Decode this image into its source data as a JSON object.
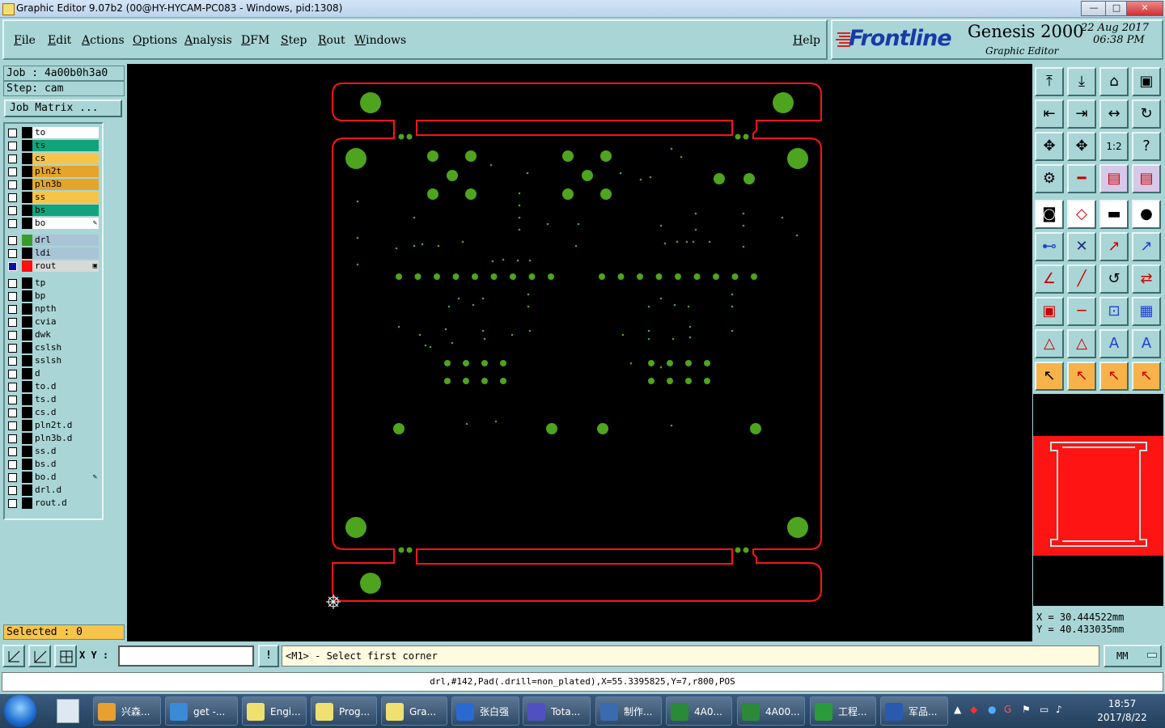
{
  "window": {
    "title": "Graphic Editor 9.07b2 (00@HY-HYCAM-PC083 - Windows, pid:1308)",
    "min": "—",
    "max": "□",
    "close": "✕"
  },
  "menu": {
    "items": [
      "File",
      "Edit",
      "Actions",
      "Options",
      "Analysis",
      "DFM",
      "Step",
      "Rout",
      "Windows"
    ],
    "help": "Help"
  },
  "brand": {
    "logo": "Frontline",
    "product": "Genesis 2000",
    "subtitle": "Graphic Editor",
    "date": "22 Aug 2017",
    "time": "06:38 PM"
  },
  "job": {
    "job_label": "Job : 4a00b0h3a0",
    "step_label": "Step: cam",
    "matrix_button": "Job Matrix ..."
  },
  "layers": [
    {
      "name": "to",
      "color": "#ffffff"
    },
    {
      "name": "ts",
      "color": "#12a37a"
    },
    {
      "name": "cs",
      "color": "#f7c44a"
    },
    {
      "name": "pln2t",
      "color": "#e4a52a"
    },
    {
      "name": "pln3b",
      "color": "#e4a52a"
    },
    {
      "name": "ss",
      "color": "#f7c44a"
    },
    {
      "name": "bs",
      "color": "#12a37a"
    },
    {
      "name": "bo",
      "color": "#ffffff",
      "flag": "✎"
    },
    {
      "name": "drl",
      "color": "#a9c4d6",
      "work": "#3a9d2a"
    },
    {
      "name": "ldi",
      "color": "#a9c4d6"
    },
    {
      "name": "rout",
      "color": "#d8d8d8",
      "work": "#ff1010",
      "checked": true,
      "flag": "▣"
    },
    {
      "name": "tp",
      "color": "#a9d5d6"
    },
    {
      "name": "bp",
      "color": "#a9d5d6"
    },
    {
      "name": "npth",
      "color": "#a9d5d6"
    },
    {
      "name": "cvia",
      "color": "#a9d5d6"
    },
    {
      "name": "dwk",
      "color": "#a9d5d6"
    },
    {
      "name": "cslsh",
      "color": "#a9d5d6"
    },
    {
      "name": "sslsh",
      "color": "#a9d5d6"
    },
    {
      "name": "d",
      "color": "#a9d5d6"
    },
    {
      "name": "to.d",
      "color": "#a9d5d6"
    },
    {
      "name": "ts.d",
      "color": "#a9d5d6"
    },
    {
      "name": "cs.d",
      "color": "#a9d5d6"
    },
    {
      "name": "pln2t.d",
      "color": "#a9d5d6"
    },
    {
      "name": "pln3b.d",
      "color": "#a9d5d6"
    },
    {
      "name": "ss.d",
      "color": "#a9d5d6"
    },
    {
      "name": "bs.d",
      "color": "#a9d5d6"
    },
    {
      "name": "bo.d",
      "color": "#a9d5d6",
      "flag": "✎"
    },
    {
      "name": "drl.d",
      "color": "#a9d5d6"
    },
    {
      "name": "rout.d",
      "color": "#a9d5d6"
    }
  ],
  "selected": "Selected : 0",
  "coords": {
    "x": "X = 30.444522mm",
    "y": "Y = 40.433035mm"
  },
  "command": {
    "xy_label": "X Y :",
    "input_value": "",
    "prompt": "<M1> - Select first corner",
    "units": "MM",
    "bang": "!"
  },
  "status": "drl,#142,Pad(.drill=non_plated),X=55.3395825,Y=7,r800,POS",
  "taskbar": {
    "items": [
      "兴森...",
      "get -...",
      "Engi...",
      "Prog...",
      "Gra...",
      "张白强",
      "Tota...",
      "制作...",
      "4A0...",
      "4A00...",
      "工程...",
      "军品..."
    ],
    "time": "18:57",
    "date": "2017/8/22"
  },
  "colors": {
    "board_outline": "#ff1414",
    "drill": "#4ea31f",
    "panel": "#a9d5d6"
  }
}
